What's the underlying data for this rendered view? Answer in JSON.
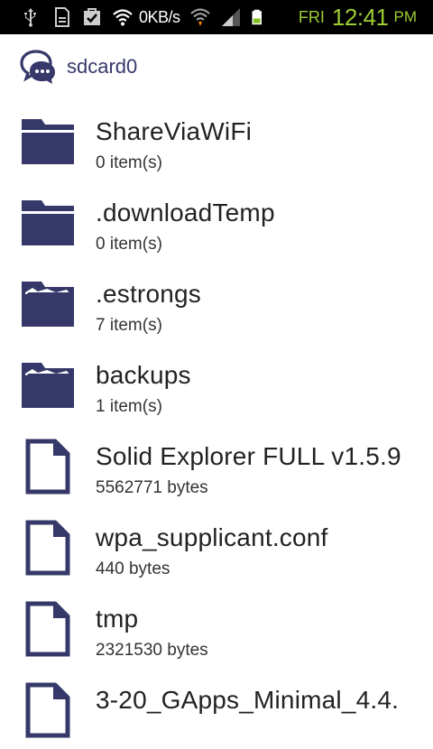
{
  "status_bar": {
    "speed": "0KB/s",
    "day": "FRI",
    "time": "12:41",
    "ampm": "PM",
    "icons": [
      "usb-icon",
      "sdcard-icon",
      "bag-check-icon",
      "wifi-icon",
      "wifi-activity-icon",
      "signal-icon",
      "battery-icon"
    ]
  },
  "header": {
    "title": "sdcard0",
    "icon": "chat-bubbles-icon",
    "accent_color": "#36386a"
  },
  "items": [
    {
      "name": "ShareViaWiFi",
      "sub": "0 item(s)",
      "type": "folder-empty"
    },
    {
      "name": ".downloadTemp",
      "sub": "0 item(s)",
      "type": "folder-empty"
    },
    {
      "name": ".estrongs",
      "sub": "7 item(s)",
      "type": "folder-open"
    },
    {
      "name": "backups",
      "sub": "1 item(s)",
      "type": "folder-open"
    },
    {
      "name": "Solid Explorer FULL v1.5.9",
      "sub": "5562771 bytes",
      "type": "file"
    },
    {
      "name": "wpa_supplicant.conf",
      "sub": "440 bytes",
      "type": "file"
    },
    {
      "name": "tmp",
      "sub": "2321530 bytes",
      "type": "file"
    },
    {
      "name": "3-20_GApps_Minimal_4.4.",
      "sub": "",
      "type": "file"
    }
  ]
}
